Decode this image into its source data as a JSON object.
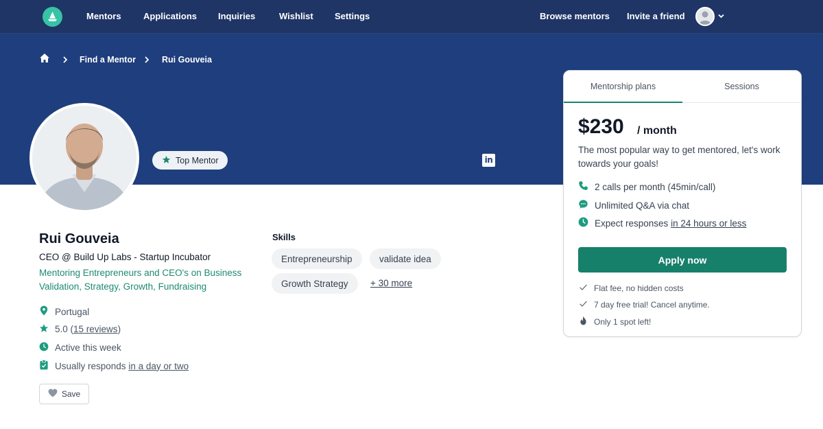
{
  "nav": {
    "links": [
      "Mentors",
      "Applications",
      "Inquiries",
      "Wishlist",
      "Settings"
    ],
    "right_links": [
      "Browse mentors",
      "Invite a friend"
    ]
  },
  "breadcrumb": [
    "Find a Mentor",
    "Rui Gouveia"
  ],
  "profile": {
    "badge": "Top Mentor",
    "name": "Rui Gouveia",
    "role": "CEO @ Build Up Labs - Startup Incubator",
    "tagline": "Mentoring Entrepreneurs and CEO's on Business Validation, Strategy, Growth, Fundraising",
    "location": "Portugal",
    "rating": "5.0",
    "reviews_link": "15 reviews",
    "activity": "Active this week",
    "responds_prefix": "Usually responds",
    "responds_link": "in a day or two",
    "save_label": "Save"
  },
  "skills": {
    "title": "Skills",
    "chips": [
      "Entrepreneurship",
      "validate idea",
      "Growth Strategy"
    ],
    "more": "+ 30 more"
  },
  "plan_card": {
    "tabs": [
      "Mentorship plans",
      "Sessions"
    ],
    "price": "$230",
    "period": "/ month",
    "description": "The most popular way to get mentored, let's work towards your goals!",
    "features": [
      "2 calls per month (45min/call)",
      "Unlimited Q&A via chat"
    ],
    "response_prefix": "Expect responses",
    "response_link": "in 24 hours or less",
    "apply_label": "Apply now",
    "perks": [
      "Flat fee, no hidden costs",
      "7 day free trial! Cancel anytime.",
      "Only 1 spot left!"
    ]
  },
  "colors": {
    "nav_bg": "#1f3566",
    "hero_bg": "#1f3e7d",
    "accent": "#17806b",
    "accent_text": "#1e8a72"
  }
}
